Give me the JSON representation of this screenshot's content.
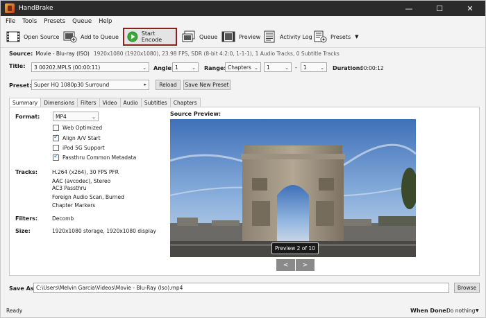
{
  "app": {
    "title": "HandBrake"
  },
  "window_controls": {
    "minimize": "—",
    "maximize": "☐",
    "close": "✕"
  },
  "menu": [
    "File",
    "Tools",
    "Presets",
    "Queue",
    "Help"
  ],
  "toolbar": {
    "open_source": "Open Source",
    "add_to_queue": "Add to Queue",
    "start_encode": "Start Encode",
    "queue": "Queue",
    "preview": "Preview",
    "activity_log": "Activity Log",
    "presets": "Presets"
  },
  "source": {
    "label": "Source:",
    "name": "Movie - Blu-ray (ISO)",
    "details": "1920x1080 (1920x1080), 23.98 FPS, SDR (8-bit 4:2:0, 1-1-1), 1 Audio Tracks, 0 Subtitle Tracks"
  },
  "title_row": {
    "title_label": "Title:",
    "title_value": "3  00202.MPLS (00:00:11)",
    "angle_label": "Angle:",
    "angle_value": "1",
    "range_label": "Range:",
    "range_value": "Chapters",
    "range_start": "1",
    "range_dash": "-",
    "range_end": "1",
    "duration_label": "Duration:",
    "duration_value": "00:00:12"
  },
  "preset_row": {
    "label": "Preset:",
    "value": "Super HQ 1080p30 Surround",
    "reload": "Reload",
    "save_new": "Save New Preset"
  },
  "tabs": [
    "Summary",
    "Dimensions",
    "Filters",
    "Video",
    "Audio",
    "Subtitles",
    "Chapters"
  ],
  "summary": {
    "format_label": "Format:",
    "format_value": "MP4",
    "options": [
      {
        "label": "Web Optimized",
        "checked": false
      },
      {
        "label": "Align A/V Start",
        "checked": true
      },
      {
        "label": "iPod 5G Support",
        "checked": false
      },
      {
        "label": "Passthru Common Metadata",
        "checked": true
      }
    ],
    "tracks_label": "Tracks:",
    "tracks": [
      "H.264 (x264), 30 FPS PFR",
      "AAC (avcodec), Stereo",
      "AC3 Passthru",
      "Foreign Audio Scan, Burned",
      "Chapter Markers"
    ],
    "filters_label": "Filters:",
    "filters_value": "Decomb",
    "size_label": "Size:",
    "size_value": "1920x1080 storage, 1920x1080 display",
    "source_preview_label": "Source Preview:",
    "preview_badge": "Preview 2 of 10",
    "prev_btn": "<",
    "next_btn": ">"
  },
  "save_as": {
    "label": "Save As:",
    "path": "C:\\Users\\Melvin Garcia\\Videos\\Movie - Blu-Ray (Iso).mp4",
    "browse": "Browse"
  },
  "status": {
    "state": "Ready",
    "when_done_label": "When Done:",
    "when_done_value": "Do nothing"
  },
  "colors": {
    "highlight_border": "#8a1f24",
    "start_green": "#3aa83a",
    "titlebar": "#2b2b2b"
  }
}
